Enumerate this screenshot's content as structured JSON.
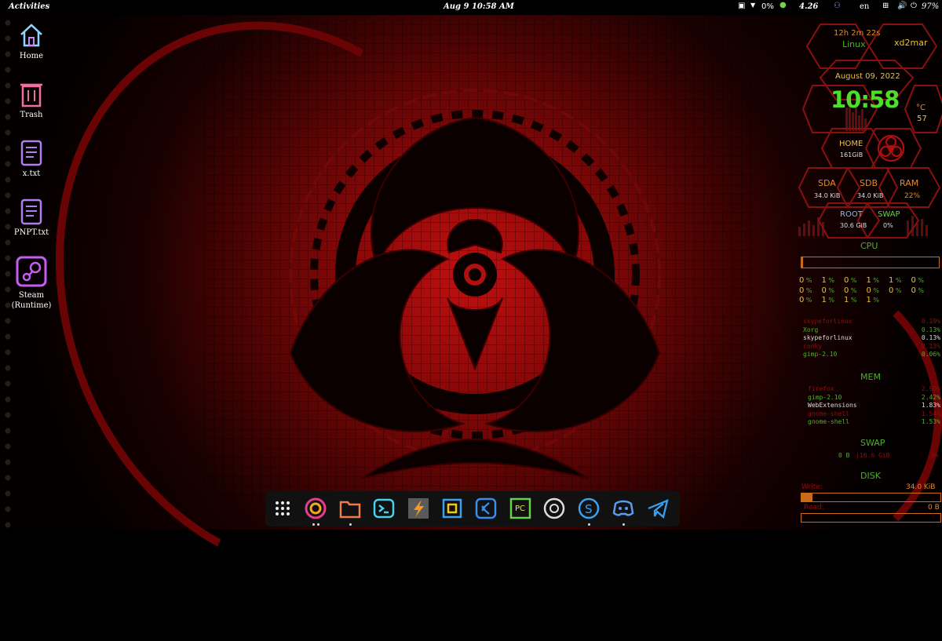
{
  "topbar": {
    "activities": "Activities",
    "clock": "Aug 9  10:58 AM",
    "cpu_percent": "0%",
    "net_speed": "4.26",
    "lang": "en",
    "battery": "97%"
  },
  "desktop": {
    "icons": [
      {
        "label": "Home"
      },
      {
        "label": "Trash"
      },
      {
        "label": "x.txt"
      },
      {
        "label": "PNPT.txt"
      },
      {
        "label": "Steam (Runtime)"
      }
    ]
  },
  "dock": {
    "apps": [
      "show-apps",
      "firefox",
      "files",
      "terminal",
      "sublime-text",
      "screenshot",
      "vscode",
      "pycharm",
      "obs",
      "skype",
      "discord",
      "telegram"
    ]
  },
  "conky": {
    "uptime": "12h 2m 22s",
    "os": "Linux",
    "user": "xd2mar",
    "date": "August 09, 2022",
    "time": "10:58",
    "temp_unit": "°C",
    "temp": "57",
    "home_label": "HOME",
    "home_value": "161GiB",
    "sda_label": "SDA",
    "sda_value": "34.0 KiB",
    "sdb_label": "SDB",
    "sdb_value": "34.0 KiB",
    "ram_label": "RAM",
    "ram_value": "22%",
    "root_label": "ROOT",
    "root_value": "30.6 GiB",
    "swap_label": "SWAP",
    "swap_value": "0%",
    "cpu_title": "CPU",
    "cpu_cores": [
      [
        "0%",
        "1%",
        "0%",
        "1%",
        "1%",
        "0%"
      ],
      [
        "0%",
        "0%",
        "0%",
        "0%",
        "0%",
        "0%"
      ],
      [
        "0%",
        "1%",
        "1%",
        "1%"
      ]
    ],
    "cpu_procs": [
      {
        "name": "skypeforlinux",
        "val": "0.19%"
      },
      {
        "name": "Xorg",
        "val": "0.13%"
      },
      {
        "name": "skypeforlinux",
        "val": "0.13%"
      },
      {
        "name": "conky",
        "val": "0.13%"
      },
      {
        "name": "gimp-2.10",
        "val": "0.06%"
      }
    ],
    "mem_title": "MEM",
    "mem_procs": [
      {
        "name": "firefox",
        "val": "2.90%"
      },
      {
        "name": "gimp-2.10",
        "val": "2.42%"
      },
      {
        "name": "WebExtensions",
        "val": "1.83%"
      },
      {
        "name": "gnome-shell",
        "val": "1.54%"
      },
      {
        "name": "gnome-shell",
        "val": "1.53%"
      }
    ],
    "swap_title": "SWAP",
    "swap_line_used": "0 B",
    "swap_line_total": "16.6 GiB",
    "swap_line_pct": "0%",
    "disk_title": "DISK",
    "write_label": "Write:",
    "write_value": "34.0 KiB",
    "read_label": "Read:",
    "read_value": "0 B",
    "write_level": 0.08,
    "read_level": 0.0,
    "cpu_level": 0.01,
    "colors": {
      "green": "#4caf2a",
      "orange": "#e08a2a",
      "red": "#8a0f14",
      "hex": "#8a1010"
    }
  }
}
